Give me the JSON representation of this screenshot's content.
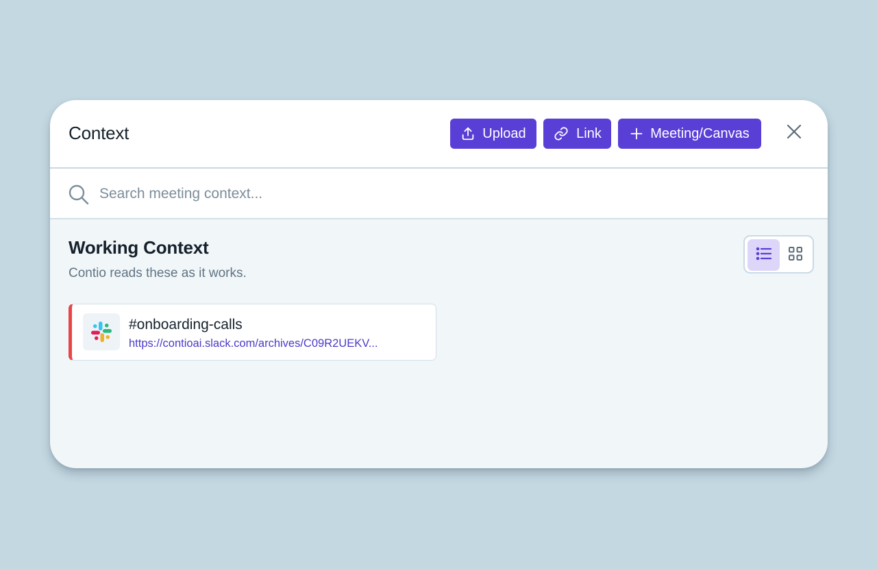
{
  "header": {
    "title": "Context",
    "buttons": {
      "upload_label": "Upload",
      "link_label": "Link",
      "meeting_label": "Meeting/Canvas"
    }
  },
  "search": {
    "placeholder": "Search meeting context..."
  },
  "working_context": {
    "title": "Working Context",
    "subtitle": "Contio reads these as it works.",
    "view_mode": "list",
    "items": [
      {
        "title": "#onboarding-calls",
        "url": "https://contioai.slack.com/archives/C09R2UEKV...",
        "icon": "slack-icon"
      }
    ]
  },
  "colors": {
    "accent": "#5a3fd6",
    "background": "#c4d8e2",
    "card_marker": "#e84646",
    "link": "#4b3ac8"
  },
  "icons": [
    "upload-icon",
    "link-icon",
    "plus-icon",
    "close-icon",
    "search-icon",
    "list-view-icon",
    "grid-view-icon",
    "slack-icon"
  ]
}
